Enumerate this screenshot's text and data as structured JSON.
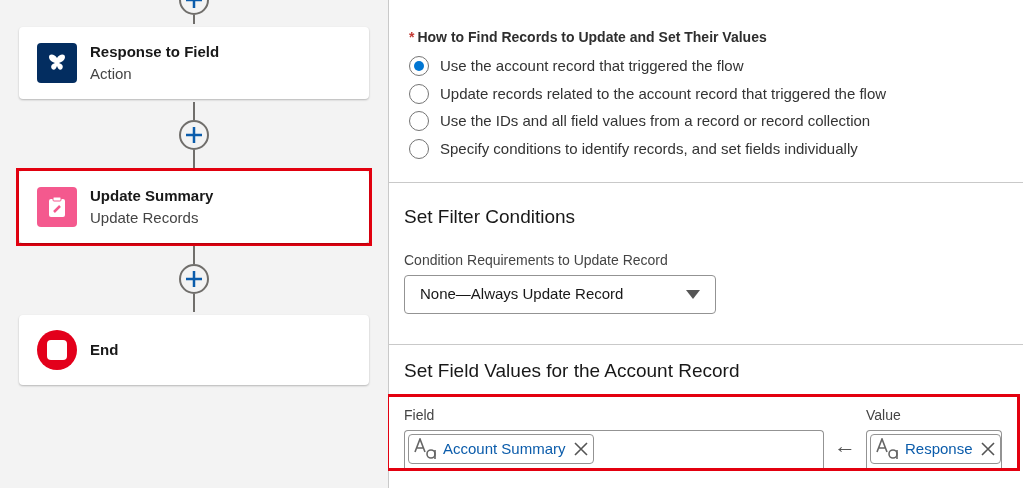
{
  "flow_nodes": [
    {
      "kind": "action",
      "title": "Response to Field",
      "subtitle": "Action",
      "highlighted": false
    },
    {
      "kind": "update",
      "title": "Update Summary",
      "subtitle": "Update Records",
      "highlighted": true
    },
    {
      "kind": "end",
      "title": "End",
      "highlighted": false
    }
  ],
  "record_options": {
    "required_mark": "*",
    "label": "How to Find Records to Update and Set Their Values",
    "options": [
      {
        "label": "Use the account record that triggered the flow",
        "selected": true
      },
      {
        "label": "Update records related to the account record that triggered the flow",
        "selected": false
      },
      {
        "label": "Use the IDs and all field values from a record or record collection",
        "selected": false
      },
      {
        "label": "Specify conditions to identify records, and set fields individually",
        "selected": false
      }
    ]
  },
  "filter_section": {
    "title": "Set Filter Conditions",
    "select_label": "Condition Requirements to Update Record",
    "select_value": "None—Always Update Record"
  },
  "field_values_section": {
    "title": "Set Field Values for the Account Record",
    "highlighted": true,
    "field_label": "Field",
    "field_pill": "Account Summary",
    "arrow": "←",
    "value_label": "Value",
    "value_pill": "Response"
  }
}
